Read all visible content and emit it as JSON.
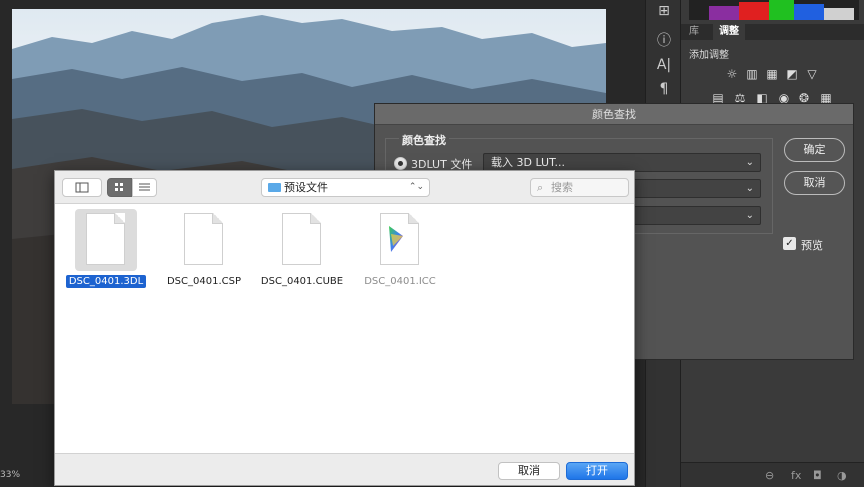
{
  "canvas": {
    "zoom": "33%"
  },
  "panel": {
    "tabs": [
      "库",
      "调整"
    ],
    "add_adjustment": "添加调整"
  },
  "lut_dialog": {
    "title": "颜色查找",
    "group_label": "颜色查找",
    "radio_label": "3DLUT 文件",
    "select_value": "载入 3D LUT...",
    "ok": "确定",
    "cancel": "取消",
    "preview_label": "预览",
    "preview_checked": true
  },
  "file_picker": {
    "folder": "预设文件",
    "search_placeholder": "搜索",
    "files": [
      {
        "name": "DSC_0401.3DL",
        "selected": true
      },
      {
        "name": "DSC_0401.CSP",
        "selected": false
      },
      {
        "name": "DSC_0401.CUBE",
        "selected": false
      },
      {
        "name": "DSC_0401.ICC",
        "selected": false,
        "dimmed": true
      }
    ],
    "cancel": "取消",
    "open": "打开"
  },
  "colors": {
    "accent": "#1d63d0",
    "open_button": "#2a7fef"
  }
}
